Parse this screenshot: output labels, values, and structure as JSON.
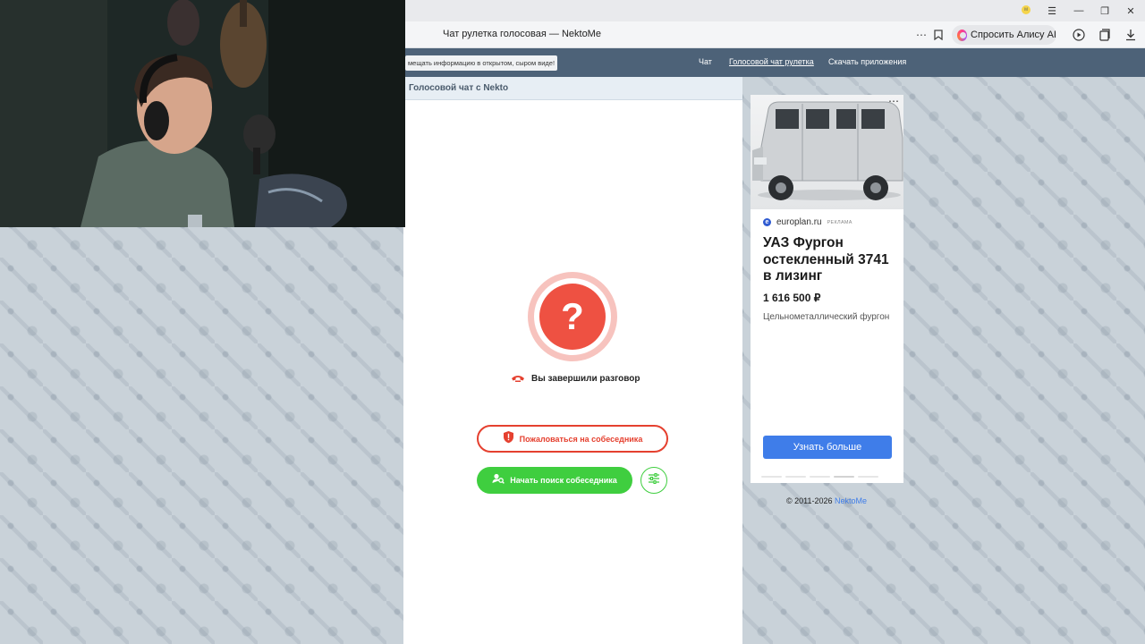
{
  "browser": {
    "tab_title": "Чат рулетка голосовая — NektoMe",
    "alice_button": "Спросить Алису AI",
    "profile_badge": "м"
  },
  "site_nav": {
    "notice": "мещать информацию в открытом, сыром виде!",
    "links": [
      {
        "label": "Чат",
        "active": false
      },
      {
        "label": "Голосовой чат рулетка",
        "active": true
      },
      {
        "label": "Скачать приложения",
        "active": false
      }
    ]
  },
  "chat": {
    "header": "Голосовой чат с Nekto",
    "status_symbol": "?",
    "status_text": "Вы завершили разговор",
    "report_button": "Пожаловаться на собеседника",
    "search_button": "Начать поиск собеседника",
    "accent_red": "#ee5142",
    "accent_green": "#3fce3f"
  },
  "ad": {
    "domain": "europlan.ru",
    "label": "РЕКЛАМА",
    "title": "УАЗ Фургон остекленный 3741 в лизинг",
    "price": "1 616 500 ₽",
    "description": "Цельнометаллический фургон",
    "cta": "Узнать больше",
    "more_icon": "⋯"
  },
  "footer": {
    "copyright": "© 2011-2026",
    "brand": "NektoMe"
  },
  "icons": {
    "phone": "phone-hangup-icon",
    "shield": "shield-alert-icon",
    "user_search": "user-search-icon",
    "filter": "sliders-icon"
  }
}
